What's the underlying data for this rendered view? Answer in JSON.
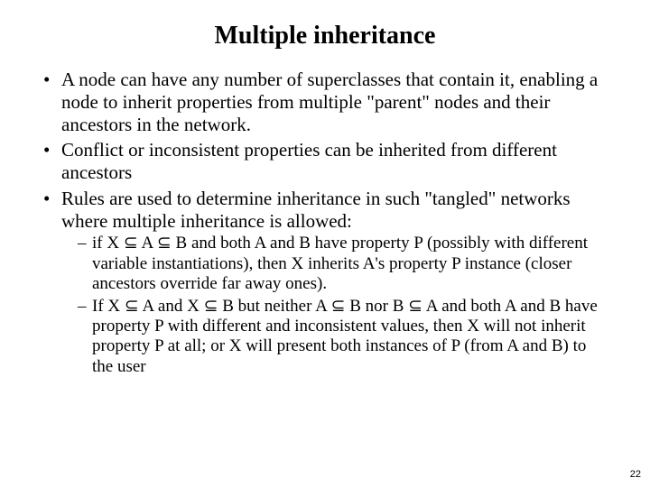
{
  "title": "Multiple inheritance",
  "bullets": [
    "A node can have any number of superclasses that contain it, enabling a node to inherit properties from multiple \"parent\" nodes and their ancestors in the network.",
    "Conflict or inconsistent properties can be inherited from different ancestors",
    "Rules are used to determine inheritance in such \"tangled\" networks where multiple inheritance is allowed:"
  ],
  "subbullets": [
    "if X ⊆ A ⊆ B and both A and B have property P (possibly with different variable instantiations), then X inherits A's property P instance (closer ancestors override far away ones).",
    "If X ⊆ A and X ⊆ B but neither A ⊆ B nor B ⊆ A and both A and B have property P with different and inconsistent values, then X will not inherit property P at all; or X will present both instances of P (from A and B) to the user"
  ],
  "page_number": "22"
}
